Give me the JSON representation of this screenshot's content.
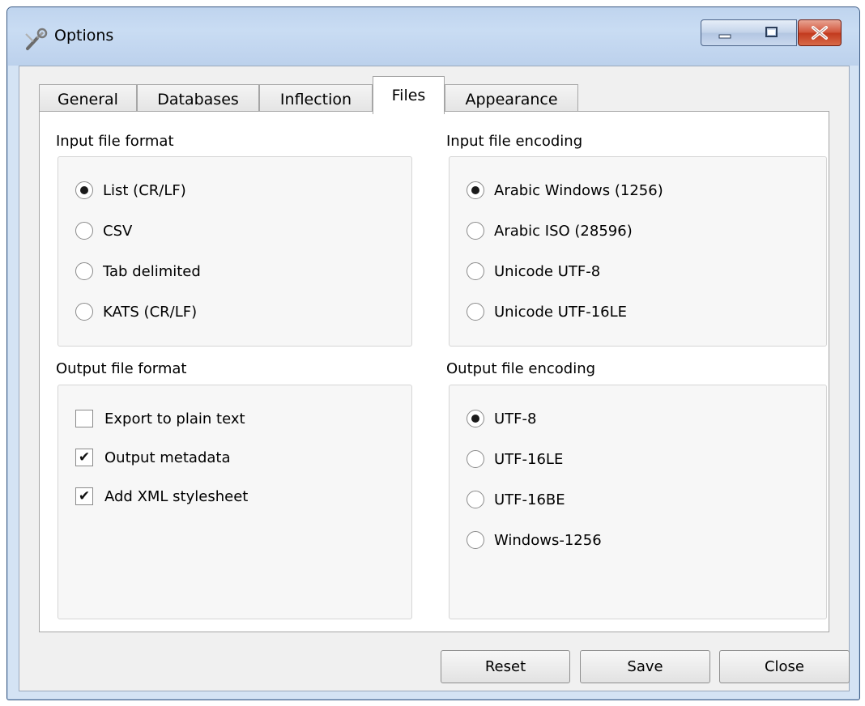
{
  "window": {
    "title": "Options",
    "icon": "wrench-icon",
    "controls": {
      "minimize": "minimize-icon",
      "maximize": "maximize-icon",
      "close": "close-icon"
    }
  },
  "tabs": [
    {
      "label": "General",
      "active": false
    },
    {
      "label": "Databases",
      "active": false
    },
    {
      "label": "Inflection",
      "active": false
    },
    {
      "label": "Files",
      "active": true
    },
    {
      "label": "Appearance",
      "active": false
    }
  ],
  "files": {
    "input_format": {
      "label": "Input file format",
      "options": [
        "List (CR/LF)",
        "CSV",
        "Tab delimited",
        "KATS (CR/LF)"
      ],
      "selected": "List (CR/LF)"
    },
    "input_encoding": {
      "label": "Input file encoding",
      "options": [
        "Arabic Windows (1256)",
        "Arabic ISO (28596)",
        "Unicode UTF-8",
        "Unicode UTF-16LE"
      ],
      "selected": "Arabic Windows (1256)"
    },
    "output_format": {
      "label": "Output file format",
      "checkboxes": [
        {
          "label": "Export to plain text",
          "checked": false
        },
        {
          "label": "Output metadata",
          "checked": true
        },
        {
          "label": "Add XML stylesheet",
          "checked": true
        }
      ]
    },
    "output_encoding": {
      "label": "Output file encoding",
      "options": [
        "UTF-8",
        "UTF-16LE",
        "UTF-16BE",
        "Windows-1256"
      ],
      "selected": "UTF-8"
    }
  },
  "buttons": {
    "reset": "Reset",
    "save": "Save",
    "close": "Close"
  }
}
